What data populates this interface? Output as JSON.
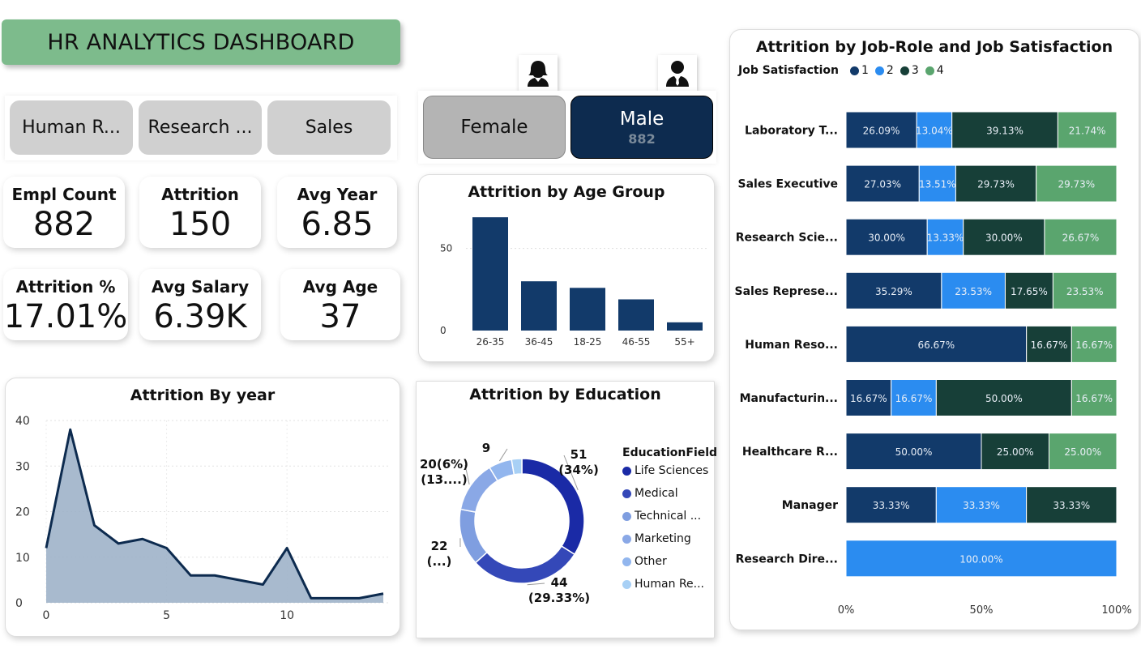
{
  "title": "HR ANALYTICS DASHBOARD",
  "department_slicer": [
    "Human R...",
    "Research ...",
    "Sales"
  ],
  "kpis": [
    {
      "label": "Empl Count",
      "value": "882"
    },
    {
      "label": "Attrition",
      "value": "150"
    },
    {
      "label": "Avg Year",
      "value": "6.85"
    },
    {
      "label": "Attrition %",
      "value": "17.01%"
    },
    {
      "label": "Avg Salary",
      "value": "6.39K"
    },
    {
      "label": "Avg Age",
      "value": "37"
    }
  ],
  "gender": {
    "female_label": "Female",
    "male_label": "Male",
    "male_count": "882",
    "selected": "Male"
  },
  "chart_data": [
    {
      "type": "bar",
      "title": "Attrition by Age Group",
      "categories": [
        "26-35",
        "36-45",
        "18-25",
        "46-55",
        "55+"
      ],
      "values": [
        69,
        30,
        26,
        19,
        5
      ],
      "y_ticks": [
        "0",
        "50"
      ],
      "ylim": [
        0,
        75
      ],
      "color": "#123a6a"
    },
    {
      "type": "area",
      "title": "Attrition By year",
      "x": [
        0,
        1,
        2,
        3,
        4,
        5,
        6,
        7,
        8,
        9,
        10,
        11,
        12,
        13,
        14
      ],
      "values": [
        12,
        38,
        17,
        13,
        14,
        12,
        6,
        6,
        5,
        4,
        12,
        1,
        1,
        1,
        2
      ],
      "x_ticks": [
        "0",
        "5",
        "10"
      ],
      "y_ticks": [
        "0",
        "10",
        "20",
        "30",
        "40"
      ],
      "ylim": [
        0,
        40
      ],
      "xlim": [
        0,
        14
      ],
      "color": "#0d2b4f",
      "fill": "#9fb2c9"
    },
    {
      "type": "pie",
      "title": "Attrition by Education",
      "legend_title": "EducationField",
      "slices": [
        {
          "name": "Life Sciences",
          "value": 51,
          "label_1": "51",
          "label_2": "(34%)",
          "color": "#1a2aa6"
        },
        {
          "name": "Medical",
          "value": 44,
          "label_1": "44",
          "label_2": "(29.33%)",
          "color": "#3448b8"
        },
        {
          "name": "Technical ...",
          "value": 22,
          "label_1": "22",
          "label_2": "(...)",
          "color": "#7f9ee0"
        },
        {
          "name": "Marketing",
          "value": 20,
          "label_1": "20(6%)",
          "label_2": "(13....)",
          "color": "#8aa8e6"
        },
        {
          "name": "Other",
          "value": 9,
          "label_1": "9",
          "label_2": "",
          "color": "#92b6ee"
        },
        {
          "name": "Human Re...",
          "value": 4,
          "label_1": "",
          "label_2": "",
          "color": "#a8d0f5"
        }
      ]
    },
    {
      "type": "bar",
      "orientation": "horizontal-stacked-100",
      "title": "Attrition by Job-Role and Job Satisfaction",
      "legend_title": "Job Satisfaction",
      "series": [
        {
          "name": "1",
          "color": "#123a6a"
        },
        {
          "name": "2",
          "color": "#2b8cf0"
        },
        {
          "name": "3",
          "color": "#173f38"
        },
        {
          "name": "4",
          "color": "#5aa56e"
        }
      ],
      "categories": [
        "Laboratory T...",
        "Sales Executive",
        "Research Scie...",
        "Sales Represe...",
        "Human Reso...",
        "Manufacturin...",
        "Healthcare R...",
        "Manager",
        "Research Dire..."
      ],
      "values": [
        [
          26.09,
          13.04,
          39.13,
          21.74
        ],
        [
          27.03,
          13.51,
          29.73,
          29.73
        ],
        [
          30.0,
          13.33,
          30.0,
          26.67
        ],
        [
          35.29,
          23.53,
          17.65,
          23.53
        ],
        [
          66.67,
          0,
          16.67,
          16.67
        ],
        [
          16.67,
          16.67,
          50.0,
          16.67
        ],
        [
          50.0,
          0,
          25.0,
          25.0
        ],
        [
          33.33,
          33.33,
          33.33,
          0
        ],
        [
          0,
          100.0,
          0,
          0
        ]
      ],
      "x_ticks": [
        "0%",
        "50%",
        "100%"
      ]
    }
  ]
}
